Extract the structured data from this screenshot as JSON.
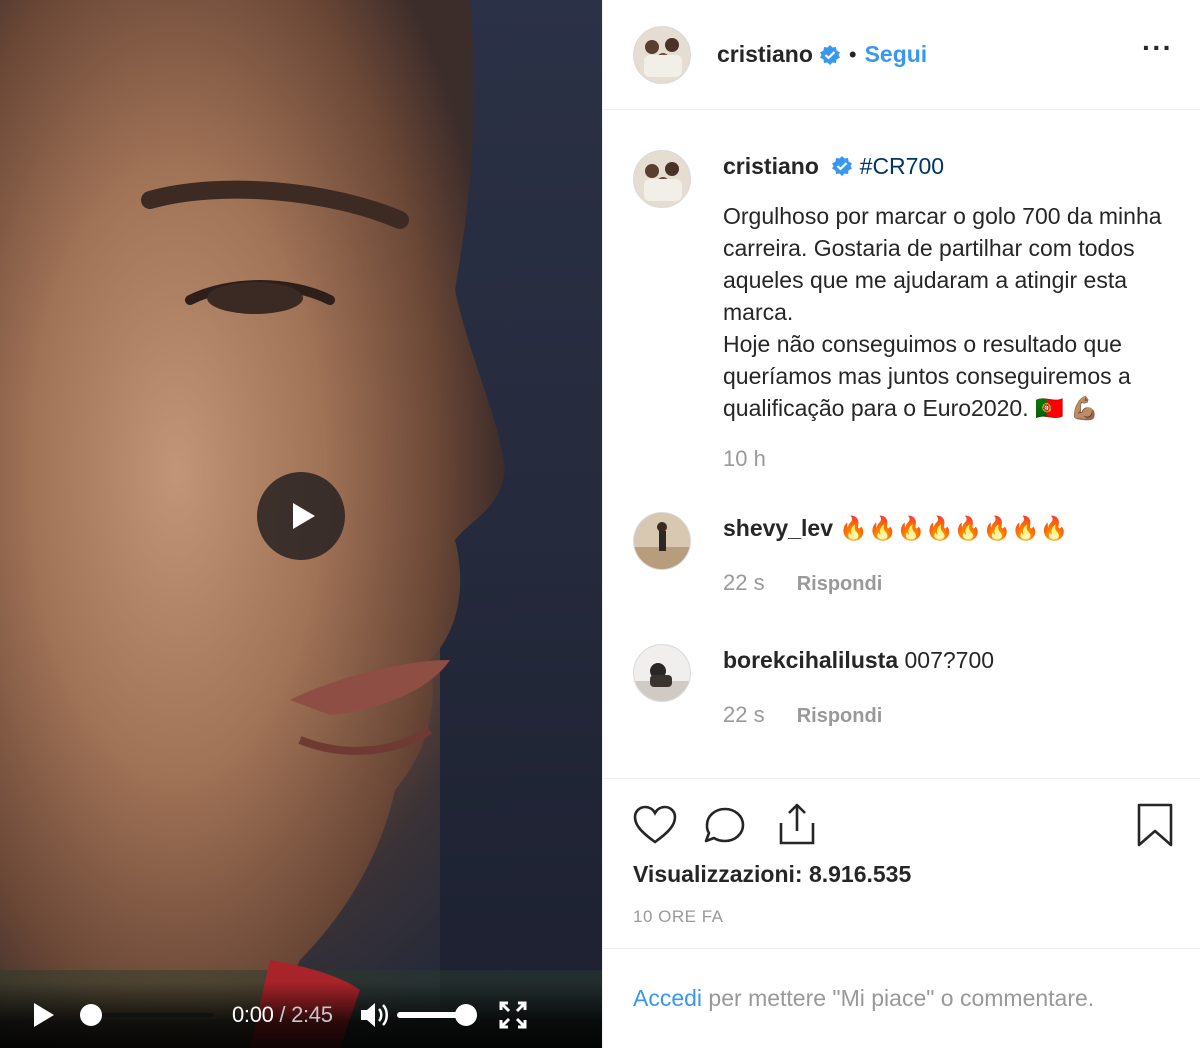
{
  "video": {
    "current_time": "0:00",
    "separator": " / ",
    "duration": "2:45",
    "progress": 0,
    "volume": 1.0
  },
  "header": {
    "username": "cristiano",
    "separator": "•",
    "follow_label": "Segui",
    "more_label": "···"
  },
  "caption": {
    "username": "cristiano",
    "hashtag": "#CR700",
    "text": "Orgulhoso por marcar o golo 700 da minha carreira. Gostaria de partilhar com todos aqueles que me ajudaram a atingir esta marca.\nHoje não conseguimos o resultado que queríamos mas juntos conseguiremos a qualificação para o Euro2020.",
    "emoji": "🇵🇹 💪🏽",
    "time": "10 h"
  },
  "comments": [
    {
      "username": "shevy_lev",
      "text": "🔥🔥🔥🔥🔥🔥🔥🔥",
      "time": "22 s",
      "reply_label": "Rispondi"
    },
    {
      "username": "borekcihalilusta",
      "text": "007?700",
      "time": "22 s",
      "reply_label": "Rispondi"
    }
  ],
  "stats": {
    "views": "Visualizzazioni: 8.916.535",
    "posted": "10 ORE FA"
  },
  "login_prompt": {
    "link": "Accedi",
    "text": " per mettere \"Mi piace\" o commentare."
  },
  "colors": {
    "link_blue": "#3897f0",
    "muted_gray": "#999999",
    "hashtag_blue": "#003569",
    "text": "#262626"
  }
}
